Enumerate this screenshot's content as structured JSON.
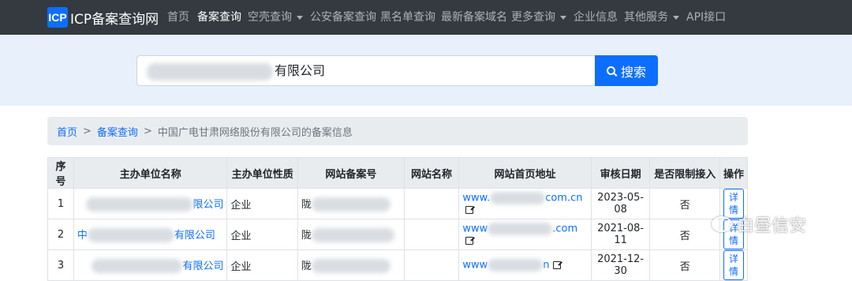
{
  "navbar": {
    "logo": "ICP",
    "brand": "ICP备案查询网",
    "items": [
      {
        "label": "首页",
        "dropdown": false
      },
      {
        "label": "备案查询",
        "dropdown": false,
        "active": true
      },
      {
        "label": "空壳查询",
        "dropdown": true
      },
      {
        "label": "公安备案查询",
        "dropdown": false
      },
      {
        "label": "黑名单查询",
        "dropdown": false
      },
      {
        "label": "最新备案域名",
        "dropdown": false
      },
      {
        "label": "更多查询",
        "dropdown": true
      },
      {
        "label": "企业信息",
        "dropdown": false
      },
      {
        "label": "其他服务",
        "dropdown": true
      },
      {
        "label": "API接口",
        "dropdown": false
      }
    ]
  },
  "search": {
    "value_suffix": "有限公司",
    "button_label": "搜索"
  },
  "breadcrumb": {
    "home": "首页",
    "section": "备案查询",
    "current": "中国广电甘肃网络股份有限公司的备案信息"
  },
  "table": {
    "headers": [
      "序号",
      "主办单位名称",
      "主办单位性质",
      "网站备案号",
      "网站名称",
      "网站首页地址",
      "审核日期",
      "是否限制接入",
      "操作"
    ],
    "rows": [
      {
        "index": "1",
        "org_suffix": "限公司",
        "org_type": "企业",
        "record_prefix": "陇",
        "site_name": "",
        "url_prefix": "www.",
        "url_suffix": "com.cn",
        "date": "2023-05-08",
        "restricted": "否",
        "action": "详情"
      },
      {
        "index": "2",
        "org_prefix": "中",
        "org_suffix": "有限公司",
        "org_type": "企业",
        "record_prefix": "陇",
        "site_name": "",
        "url_prefix": "www",
        "url_suffix": ".com",
        "date": "2021-08-11",
        "restricted": "否",
        "action": "详情"
      },
      {
        "index": "3",
        "org_suffix": "有限公司",
        "org_type": "企业",
        "record_prefix": "陇",
        "site_name": "",
        "url_prefix": "www",
        "url_suffix": "n",
        "date": "2021-12-30",
        "restricted": "否",
        "action": "详情"
      }
    ]
  },
  "watermark": "白昼信安"
}
